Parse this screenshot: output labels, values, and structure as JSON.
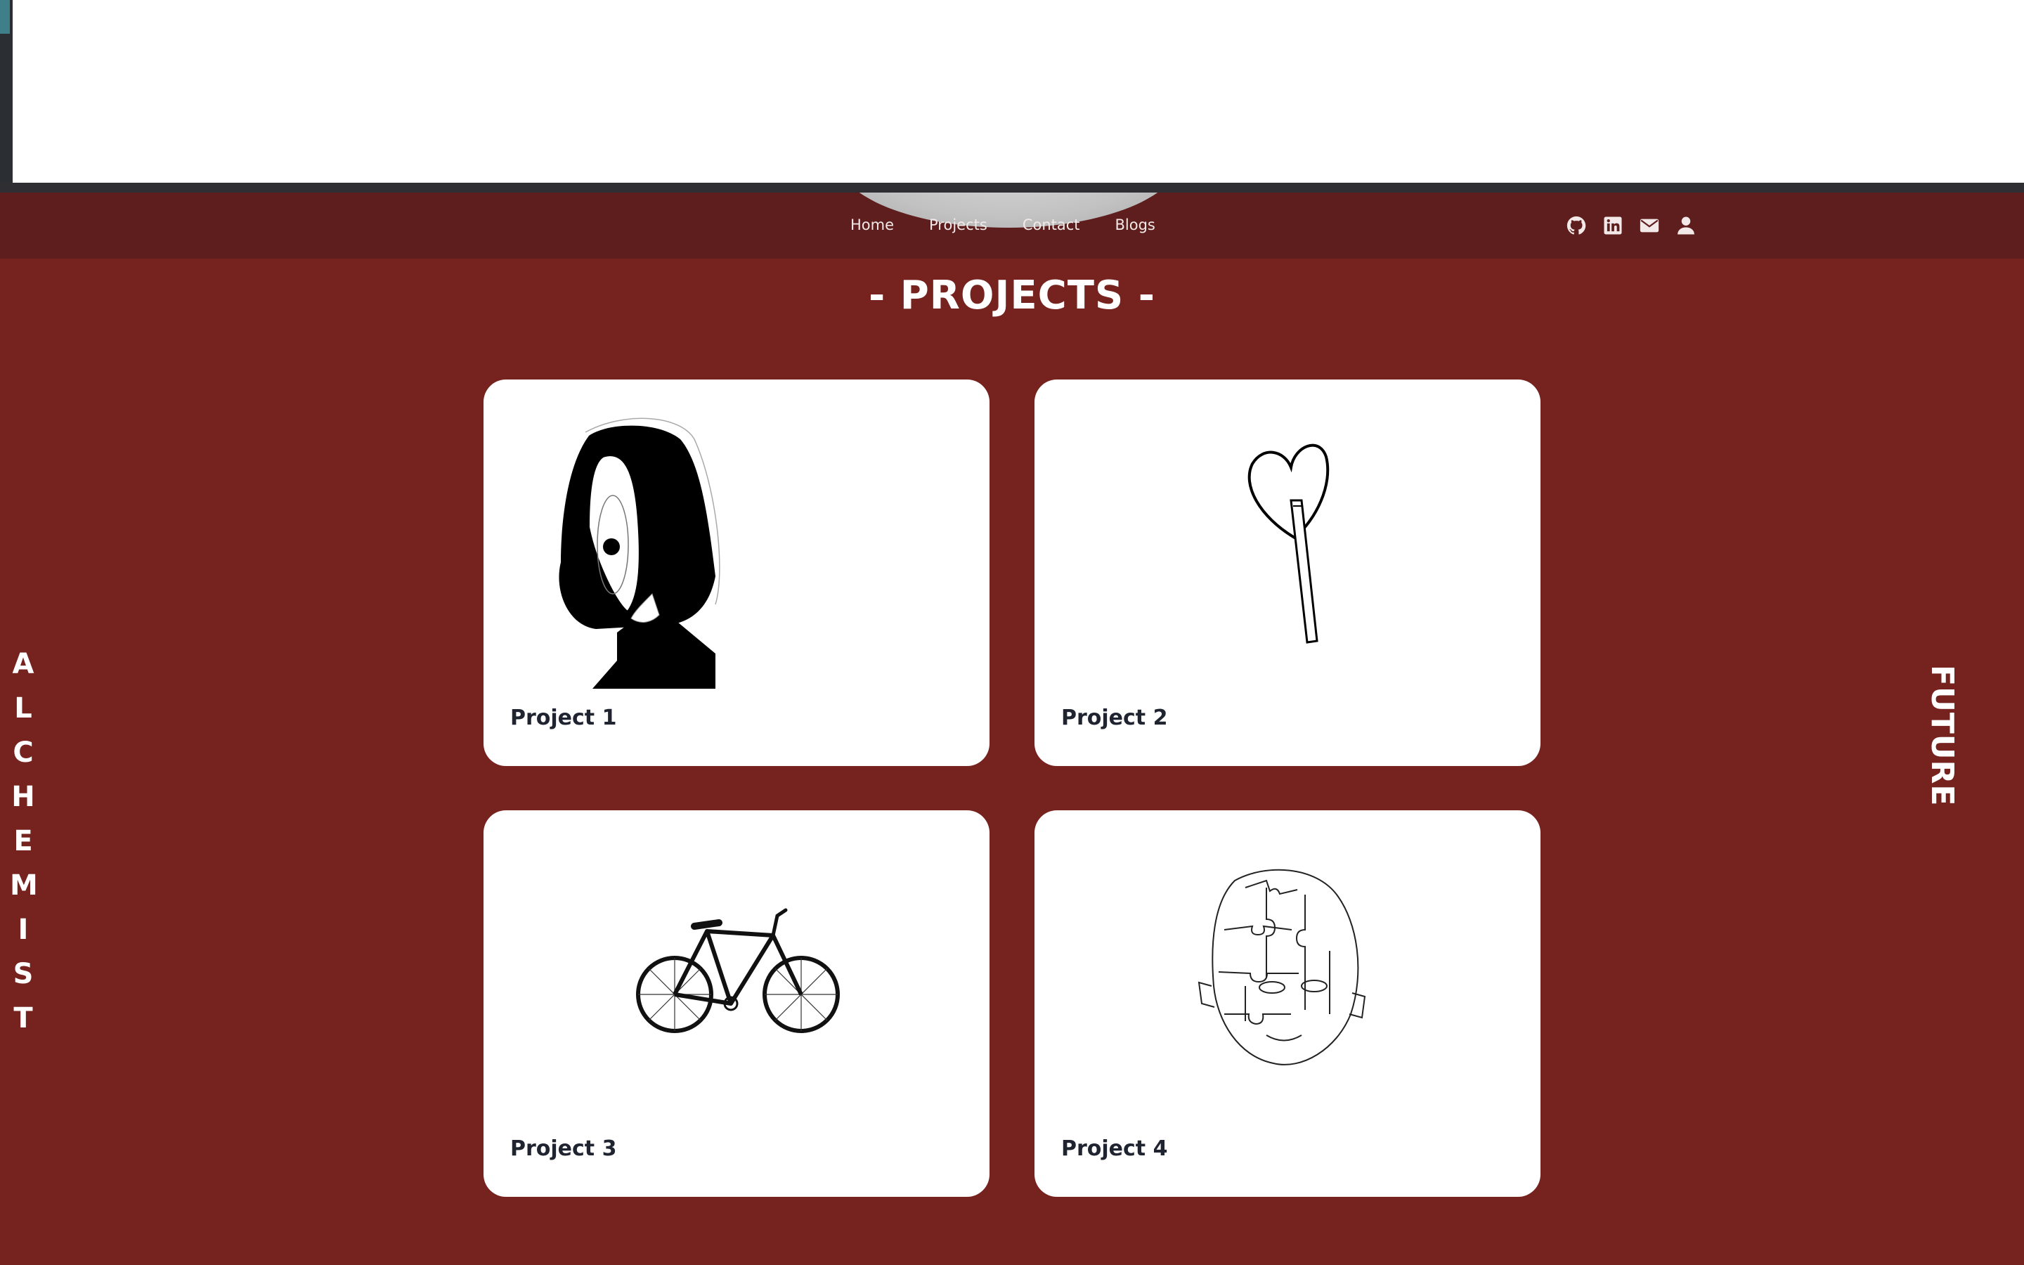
{
  "nav": {
    "links": [
      "Home",
      "Projects",
      "Contact",
      "Blogs"
    ],
    "icons": [
      "github-icon",
      "linkedin-icon",
      "mail-icon",
      "user-icon"
    ]
  },
  "page": {
    "title": "- PROJECTS -",
    "side_left": "ALCHEMIST",
    "side_right": "FUTURE"
  },
  "projects": [
    {
      "label": "Project 1",
      "art": "one-eyed-girl-illustration"
    },
    {
      "label": "Project 2",
      "art": "heart-lollipop-illustration"
    },
    {
      "label": "Project 3",
      "art": "bicycle-illustration"
    },
    {
      "label": "Project 4",
      "art": "puzzle-face-illustration"
    }
  ],
  "colors": {
    "background": "#76231f",
    "navbar": "#5e1e1d",
    "card": "#ffffff",
    "text_light": "#ffffff"
  }
}
